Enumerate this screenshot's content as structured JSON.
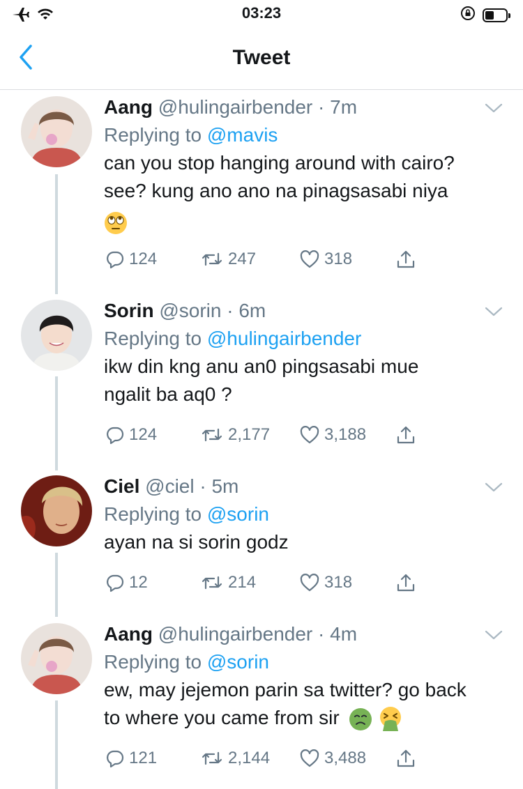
{
  "status_bar": {
    "time": "03:23"
  },
  "nav": {
    "title": "Tweet"
  },
  "tweets": [
    {
      "name": "Aang",
      "handle": "@hulingairbender",
      "time": "· 7m",
      "replying_prefix": "Replying to ",
      "replying_to": "@mavis",
      "line1": "can you stop hanging around with cairo?",
      "line2": "see? kung ano ano na pinagsasabi niya",
      "replies": "124",
      "retweets": "247",
      "likes": "318"
    },
    {
      "name": "Sorin",
      "handle": "@sorin",
      "time": "· 6m",
      "replying_prefix": "Replying to ",
      "replying_to": "@hulingairbender",
      "line1": "ikw din kng anu an0 pingsasabi mue",
      "line2": "ngalit ba aq0 ?",
      "replies": "124",
      "retweets": "2,177",
      "likes": "3,188"
    },
    {
      "name": "Ciel",
      "handle": "@ciel",
      "time": "· 5m",
      "replying_prefix": "Replying to ",
      "replying_to": "@sorin",
      "line1": "ayan na si sorin godz",
      "replies": "12",
      "retweets": "214",
      "likes": "318"
    },
    {
      "name": "Aang",
      "handle": "@hulingairbender",
      "time": "· 4m",
      "replying_prefix": "Replying to ",
      "replying_to": "@sorin",
      "line1": "ew, may jejemon parin sa twitter? go back",
      "line2": "to where you came from sir",
      "replies": "121",
      "retweets": "2,144",
      "likes": "3,488"
    }
  ],
  "colors": {
    "link": "#1da1f2",
    "muted": "#657786",
    "text": "#14171a",
    "thread": "#cfd9de"
  },
  "icons": [
    "airplane-icon",
    "wifi-icon",
    "orientation-lock-icon",
    "battery-icon",
    "back-chevron-icon",
    "chevron-down-icon",
    "reply-icon",
    "retweet-icon",
    "like-icon",
    "share-icon",
    "eye-roll-emoji",
    "nauseated-emoji",
    "vomiting-emoji"
  ]
}
